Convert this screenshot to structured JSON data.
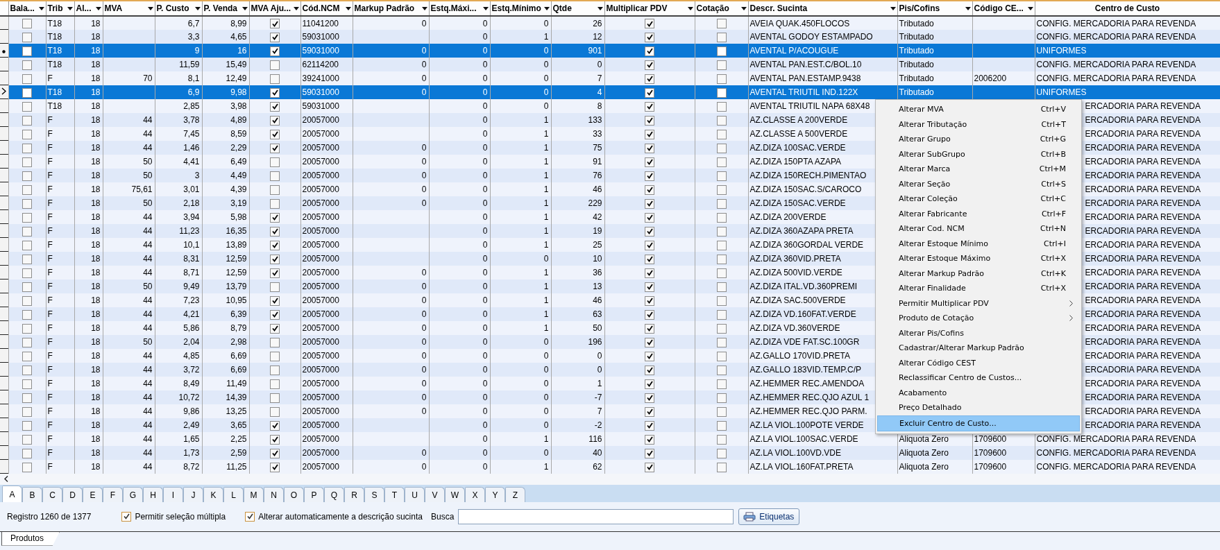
{
  "table": {
    "columns": [
      {
        "label": "Bala...",
        "filter": true
      },
      {
        "label": "Trib",
        "filter": true
      },
      {
        "label": "Al...",
        "filter": true
      },
      {
        "label": "MVA",
        "filter": true
      },
      {
        "label": "P. Custo",
        "filter": true
      },
      {
        "label": "P. Venda",
        "filter": true
      },
      {
        "label": "MVA Aju...",
        "filter": true
      },
      {
        "label": "Cód.NCM",
        "filter": true
      },
      {
        "label": "Markup Padrão",
        "filter": true
      },
      {
        "label": "Estq.Máxi...",
        "filter": true
      },
      {
        "label": "Estq.Mínimo",
        "filter": true
      },
      {
        "label": "Qtde",
        "filter": true
      },
      {
        "label": "Multiplicar PDV",
        "filter": true
      },
      {
        "label": "Cotação",
        "filter": true
      },
      {
        "label": "Descr. Sucinta",
        "filter": true
      },
      {
        "label": "Pis/Cofins",
        "filter": true
      },
      {
        "label": "Código CE...",
        "filter": true
      },
      {
        "label": "Centro de Custo",
        "filter": false
      }
    ],
    "rows": [
      {
        "selected": false,
        "current": false,
        "balanca": false,
        "trib": "T18",
        "aliq": "18",
        "p_custo": "6,7",
        "p_venda": "8,99",
        "mva_ajustado": true,
        "cod_ncm": "11041200",
        "markup": "0",
        "estq_max": "0",
        "estq_min": "0",
        "qtde": "26",
        "mult_pdv": true,
        "cotacao": false,
        "descr": "AVEIA QUAK.450FLOCOS",
        "pis_cofins": "Tributado",
        "centro_custo": "CONFIG. MERCADORIA PARA REVENDA"
      },
      {
        "selected": false,
        "current": false,
        "balanca": false,
        "trib": "T18",
        "aliq": "18",
        "p_custo": "3,3",
        "p_venda": "4,65",
        "mva_ajustado": true,
        "cod_ncm": "59031000",
        "estq_max": "0",
        "estq_min": "1",
        "qtde": "12",
        "mult_pdv": true,
        "cotacao": false,
        "descr": "AVENTAL GODOY ESTAMPADO",
        "pis_cofins": "Tributado",
        "centro_custo": "CONFIG. MERCADORIA PARA REVENDA"
      },
      {
        "selected": true,
        "current": false,
        "balanca": false,
        "trib": "T18",
        "aliq": "18",
        "p_custo": "9",
        "p_venda": "16",
        "mva_ajustado": true,
        "cod_ncm": "59031000",
        "markup": "0",
        "estq_max": "0",
        "estq_min": "0",
        "qtde": "901",
        "mult_pdv": true,
        "cotacao": false,
        "descr": "AVENTAL P/ACOUGUE",
        "pis_cofins": "Tributado",
        "centro_custo": "UNIFORMES"
      },
      {
        "selected": false,
        "current": false,
        "balanca": false,
        "trib": "T18",
        "aliq": "18",
        "p_custo": "11,59",
        "p_venda": "15,49",
        "mva_ajustado": false,
        "cod_ncm": "62114200",
        "markup": "0",
        "estq_max": "0",
        "estq_min": "0",
        "qtde": "0",
        "mult_pdv": true,
        "cotacao": false,
        "descr": "AVENTAL PAN.EST.C/BOL.10",
        "pis_cofins": "Tributado",
        "centro_custo": "CONFIG. MERCADORIA PARA REVENDA"
      },
      {
        "selected": false,
        "current": false,
        "balanca": false,
        "trib": "F",
        "aliq": "18",
        "mva": "70",
        "p_custo": "8,1",
        "p_venda": "12,49",
        "mva_ajustado": false,
        "cod_ncm": "39241000",
        "markup": "0",
        "estq_max": "0",
        "estq_min": "0",
        "qtde": "7",
        "mult_pdv": true,
        "cotacao": false,
        "descr": "AVENTAL PAN.ESTAMP.9438",
        "pis_cofins": "Tributado",
        "cest": "2006200",
        "centro_custo": "CONFIG. MERCADORIA PARA REVENDA"
      },
      {
        "selected": true,
        "current": true,
        "balanca": false,
        "trib": "T18",
        "aliq": "18",
        "p_custo": "6,9",
        "p_venda": "9,98",
        "mva_ajustado": true,
        "cod_ncm": "59031000",
        "markup": "0",
        "estq_max": "0",
        "estq_min": "0",
        "qtde": "4",
        "mult_pdv": true,
        "cotacao": false,
        "descr": "AVENTAL TRIUTIL IND.122X",
        "pis_cofins": "Tributado",
        "centro_custo": "UNIFORMES"
      },
      {
        "selected": false,
        "current": false,
        "balanca": false,
        "trib": "T18",
        "aliq": "18",
        "p_custo": "2,85",
        "p_venda": "3,98",
        "mva_ajustado": true,
        "cod_ncm": "59031000",
        "estq_max": "0",
        "estq_min": "0",
        "qtde": "8",
        "mult_pdv": true,
        "cotacao": false,
        "descr": "AVENTAL TRIUTIL NAPA 68X48",
        "centro_custo": "ERCADORIA PARA REVENDA"
      },
      {
        "selected": false,
        "current": false,
        "balanca": false,
        "trib": "F",
        "aliq": "18",
        "mva": "44",
        "p_custo": "3,78",
        "p_venda": "4,89",
        "mva_ajustado": true,
        "cod_ncm": "20057000",
        "estq_max": "0",
        "estq_min": "1",
        "qtde": "133",
        "mult_pdv": true,
        "cotacao": false,
        "descr": "AZ.CLASSE A 200VERDE",
        "centro_custo": "ERCADORIA PARA REVENDA"
      },
      {
        "selected": false,
        "current": false,
        "balanca": false,
        "trib": "F",
        "aliq": "18",
        "mva": "44",
        "p_custo": "7,45",
        "p_venda": "8,59",
        "mva_ajustado": true,
        "cod_ncm": "20057000",
        "estq_max": "0",
        "estq_min": "1",
        "qtde": "33",
        "mult_pdv": true,
        "cotacao": false,
        "descr": "AZ.CLASSE A 500VERDE",
        "centro_custo": "ERCADORIA PARA REVENDA"
      },
      {
        "selected": false,
        "current": false,
        "balanca": false,
        "trib": "F",
        "aliq": "18",
        "mva": "44",
        "p_custo": "1,46",
        "p_venda": "2,29",
        "mva_ajustado": true,
        "cod_ncm": "20057000",
        "markup": "0",
        "estq_max": "0",
        "estq_min": "1",
        "qtde": "75",
        "mult_pdv": true,
        "cotacao": false,
        "descr": "AZ.DIZA 100SAC.VERDE",
        "centro_custo": "ERCADORIA PARA REVENDA"
      },
      {
        "selected": false,
        "current": false,
        "balanca": false,
        "trib": "F",
        "aliq": "18",
        "mva": "50",
        "p_custo": "4,41",
        "p_venda": "6,49",
        "mva_ajustado": false,
        "cod_ncm": "20057000",
        "markup": "0",
        "estq_max": "0",
        "estq_min": "1",
        "qtde": "91",
        "mult_pdv": true,
        "cotacao": false,
        "descr": "AZ.DIZA 150PTA AZAPA",
        "centro_custo": "ERCADORIA PARA REVENDA"
      },
      {
        "selected": false,
        "current": false,
        "balanca": false,
        "trib": "F",
        "aliq": "18",
        "mva": "50",
        "p_custo": "3",
        "p_venda": "4,49",
        "mva_ajustado": false,
        "cod_ncm": "20057000",
        "markup": "0",
        "estq_max": "0",
        "estq_min": "1",
        "qtde": "76",
        "mult_pdv": true,
        "cotacao": false,
        "descr": "AZ.DIZA 150RECH.PIMENTAO",
        "centro_custo": "ERCADORIA PARA REVENDA"
      },
      {
        "selected": false,
        "current": false,
        "balanca": false,
        "trib": "F",
        "aliq": "18",
        "mva": "75,61",
        "p_custo": "3,01",
        "p_venda": "4,39",
        "mva_ajustado": false,
        "cod_ncm": "20057000",
        "markup": "0",
        "estq_max": "0",
        "estq_min": "1",
        "qtde": "46",
        "mult_pdv": true,
        "cotacao": false,
        "descr": "AZ.DIZA 150SAC.S/CAROCO",
        "centro_custo": "ERCADORIA PARA REVENDA"
      },
      {
        "selected": false,
        "current": false,
        "balanca": false,
        "trib": "F",
        "aliq": "18",
        "mva": "50",
        "p_custo": "2,18",
        "p_venda": "3,19",
        "mva_ajustado": false,
        "cod_ncm": "20057000",
        "markup": "0",
        "estq_max": "0",
        "estq_min": "1",
        "qtde": "229",
        "mult_pdv": true,
        "cotacao": false,
        "descr": "AZ.DIZA 150SAC.VERDE",
        "centro_custo": "ERCADORIA PARA REVENDA"
      },
      {
        "selected": false,
        "current": false,
        "balanca": false,
        "trib": "F",
        "aliq": "18",
        "mva": "44",
        "p_custo": "3,94",
        "p_venda": "5,98",
        "mva_ajustado": true,
        "cod_ncm": "20057000",
        "estq_max": "0",
        "estq_min": "1",
        "qtde": "42",
        "mult_pdv": true,
        "cotacao": false,
        "descr": "AZ.DIZA 200VERDE",
        "centro_custo": "ERCADORIA PARA REVENDA"
      },
      {
        "selected": false,
        "current": false,
        "balanca": false,
        "trib": "F",
        "aliq": "18",
        "mva": "44",
        "p_custo": "11,23",
        "p_venda": "16,35",
        "mva_ajustado": true,
        "cod_ncm": "20057000",
        "estq_max": "0",
        "estq_min": "1",
        "qtde": "19",
        "mult_pdv": true,
        "cotacao": false,
        "descr": "AZ.DIZA 360AZAPA PRETA",
        "centro_custo": "ERCADORIA PARA REVENDA"
      },
      {
        "selected": false,
        "current": false,
        "balanca": false,
        "trib": "F",
        "aliq": "18",
        "mva": "44",
        "p_custo": "10,1",
        "p_venda": "13,89",
        "mva_ajustado": true,
        "cod_ncm": "20057000",
        "estq_max": "0",
        "estq_min": "1",
        "qtde": "25",
        "mult_pdv": true,
        "cotacao": false,
        "descr": "AZ.DIZA 360GORDAL VERDE",
        "centro_custo": "ERCADORIA PARA REVENDA"
      },
      {
        "selected": false,
        "current": false,
        "balanca": false,
        "trib": "F",
        "aliq": "18",
        "mva": "44",
        "p_custo": "8,31",
        "p_venda": "12,59",
        "mva_ajustado": true,
        "cod_ncm": "20057000",
        "estq_max": "0",
        "estq_min": "0",
        "qtde": "10",
        "mult_pdv": true,
        "cotacao": false,
        "descr": "AZ.DIZA 360VID.PRETA",
        "centro_custo": "ERCADORIA PARA REVENDA"
      },
      {
        "selected": false,
        "current": false,
        "balanca": false,
        "trib": "F",
        "aliq": "18",
        "mva": "44",
        "p_custo": "8,71",
        "p_venda": "12,59",
        "mva_ajustado": true,
        "cod_ncm": "20057000",
        "markup": "0",
        "estq_max": "0",
        "estq_min": "1",
        "qtde": "36",
        "mult_pdv": true,
        "cotacao": false,
        "descr": "AZ.DIZA 500VID.VERDE",
        "centro_custo": "ERCADORIA PARA REVENDA"
      },
      {
        "selected": false,
        "current": false,
        "balanca": false,
        "trib": "F",
        "aliq": "18",
        "mva": "50",
        "p_custo": "9,49",
        "p_venda": "13,79",
        "mva_ajustado": false,
        "cod_ncm": "20057000",
        "markup": "0",
        "estq_max": "0",
        "estq_min": "1",
        "qtde": "13",
        "mult_pdv": true,
        "cotacao": false,
        "descr": "AZ.DIZA ITAL.VD.360PREMI",
        "centro_custo": "ERCADORIA PARA REVENDA"
      },
      {
        "selected": false,
        "current": false,
        "balanca": false,
        "trib": "F",
        "aliq": "18",
        "mva": "44",
        "p_custo": "7,23",
        "p_venda": "10,95",
        "mva_ajustado": true,
        "cod_ncm": "20057000",
        "markup": "0",
        "estq_max": "0",
        "estq_min": "1",
        "qtde": "46",
        "mult_pdv": true,
        "cotacao": false,
        "descr": "AZ.DIZA SAC.500VERDE",
        "centro_custo": "ERCADORIA PARA REVENDA"
      },
      {
        "selected": false,
        "current": false,
        "balanca": false,
        "trib": "F",
        "aliq": "18",
        "mva": "44",
        "p_custo": "4,21",
        "p_venda": "6,39",
        "mva_ajustado": true,
        "cod_ncm": "20057000",
        "markup": "0",
        "estq_max": "0",
        "estq_min": "1",
        "qtde": "63",
        "mult_pdv": true,
        "cotacao": false,
        "descr": "AZ.DIZA VD.160FAT.VERDE",
        "centro_custo": "ERCADORIA PARA REVENDA"
      },
      {
        "selected": false,
        "current": false,
        "balanca": false,
        "trib": "F",
        "aliq": "18",
        "mva": "44",
        "p_custo": "5,86",
        "p_venda": "8,79",
        "mva_ajustado": true,
        "cod_ncm": "20057000",
        "markup": "0",
        "estq_max": "0",
        "estq_min": "1",
        "qtde": "50",
        "mult_pdv": true,
        "cotacao": false,
        "descr": "AZ.DIZA VD.360VERDE",
        "centro_custo": "ERCADORIA PARA REVENDA"
      },
      {
        "selected": false,
        "current": false,
        "balanca": false,
        "trib": "F",
        "aliq": "18",
        "mva": "50",
        "p_custo": "2,04",
        "p_venda": "2,98",
        "mva_ajustado": false,
        "cod_ncm": "20057000",
        "markup": "0",
        "estq_max": "0",
        "estq_min": "0",
        "qtde": "196",
        "mult_pdv": true,
        "cotacao": false,
        "descr": "AZ.DIZA VDE FAT.SC.100GR",
        "centro_custo": "ERCADORIA PARA REVENDA"
      },
      {
        "selected": false,
        "current": false,
        "balanca": false,
        "trib": "F",
        "aliq": "18",
        "mva": "44",
        "p_custo": "4,85",
        "p_venda": "6,69",
        "mva_ajustado": false,
        "cod_ncm": "20057000",
        "markup": "0",
        "estq_max": "0",
        "estq_min": "0",
        "qtde": "0",
        "mult_pdv": true,
        "cotacao": false,
        "descr": "AZ.GALLO 170VID.PRETA",
        "centro_custo": "ERCADORIA PARA REVENDA"
      },
      {
        "selected": false,
        "current": false,
        "balanca": false,
        "trib": "F",
        "aliq": "18",
        "mva": "44",
        "p_custo": "3,72",
        "p_venda": "6,69",
        "mva_ajustado": false,
        "cod_ncm": "20057000",
        "markup": "0",
        "estq_max": "0",
        "estq_min": "0",
        "qtde": "0",
        "mult_pdv": true,
        "cotacao": false,
        "descr": "AZ.GALLO 183VID.TEMP.C/P",
        "centro_custo": "ERCADORIA PARA REVENDA"
      },
      {
        "selected": false,
        "current": false,
        "balanca": false,
        "trib": "F",
        "aliq": "18",
        "mva": "44",
        "p_custo": "8,49",
        "p_venda": "11,49",
        "mva_ajustado": false,
        "cod_ncm": "20057000",
        "markup": "0",
        "estq_max": "0",
        "estq_min": "0",
        "qtde": "1",
        "mult_pdv": true,
        "cotacao": false,
        "descr": "AZ.HEMMER REC.AMENDOA",
        "centro_custo": "ERCADORIA PARA REVENDA"
      },
      {
        "selected": false,
        "current": false,
        "balanca": false,
        "trib": "F",
        "aliq": "18",
        "mva": "44",
        "p_custo": "10,72",
        "p_venda": "14,39",
        "mva_ajustado": false,
        "cod_ncm": "20057000",
        "markup": "0",
        "estq_max": "0",
        "estq_min": "0",
        "qtde": "-7",
        "mult_pdv": true,
        "cotacao": false,
        "descr": "AZ.HEMMER REC.QJO AZUL 1",
        "centro_custo": "ERCADORIA PARA REVENDA"
      },
      {
        "selected": false,
        "current": false,
        "balanca": false,
        "trib": "F",
        "aliq": "18",
        "mva": "44",
        "p_custo": "9,86",
        "p_venda": "13,25",
        "mva_ajustado": false,
        "cod_ncm": "20057000",
        "markup": "0",
        "estq_max": "0",
        "estq_min": "0",
        "qtde": "7",
        "mult_pdv": true,
        "cotacao": false,
        "descr": "AZ.HEMMER REC.QJO PARM.",
        "centro_custo": "ERCADORIA PARA REVENDA"
      },
      {
        "selected": false,
        "current": false,
        "balanca": false,
        "trib": "F",
        "aliq": "18",
        "mva": "44",
        "p_custo": "2,49",
        "p_venda": "3,65",
        "mva_ajustado": true,
        "cod_ncm": "20057000",
        "estq_max": "0",
        "estq_min": "0",
        "qtde": "-2",
        "mult_pdv": true,
        "cotacao": false,
        "descr": "AZ.LA VIOL.100POTE VERDE",
        "centro_custo": "ERCADORIA PARA REVENDA"
      },
      {
        "selected": false,
        "current": false,
        "balanca": false,
        "trib": "F",
        "aliq": "18",
        "mva": "44",
        "p_custo": "1,65",
        "p_venda": "2,25",
        "mva_ajustado": true,
        "cod_ncm": "20057000",
        "estq_max": "0",
        "estq_min": "1",
        "qtde": "116",
        "mult_pdv": true,
        "cotacao": false,
        "descr": "AZ.LA VIOL.100SAC.VERDE",
        "pis_cofins": "Aliquota Zero",
        "cest": "1709600",
        "centro_custo": "CONFIG. MERCADORIA PARA REVENDA"
      },
      {
        "selected": false,
        "current": false,
        "balanca": false,
        "trib": "F",
        "aliq": "18",
        "mva": "44",
        "p_custo": "1,73",
        "p_venda": "2,59",
        "mva_ajustado": true,
        "cod_ncm": "20057000",
        "markup": "0",
        "estq_max": "0",
        "estq_min": "0",
        "qtde": "40",
        "mult_pdv": true,
        "cotacao": false,
        "descr": "AZ.LA VIOL.100VD.VDE",
        "pis_cofins": "Aliquota Zero",
        "cest": "1709600",
        "centro_custo": "CONFIG. MERCADORIA PARA REVENDA"
      },
      {
        "selected": false,
        "current": false,
        "balanca": false,
        "trib": "F",
        "aliq": "18",
        "mva": "44",
        "p_custo": "8,72",
        "p_venda": "11,25",
        "mva_ajustado": true,
        "cod_ncm": "20057000",
        "markup": "0",
        "estq_max": "0",
        "estq_min": "1",
        "qtde": "62",
        "mult_pdv": true,
        "cotacao": false,
        "descr": "AZ.LA VIOL.160FAT.PRETA",
        "pis_cofins": "Aliquota Zero",
        "cest": "1709600",
        "centro_custo": "CONFIG. MERCADORIA PARA REVENDA"
      }
    ]
  },
  "context_menu": {
    "items": [
      {
        "label": "Alterar MVA",
        "shortcut": "Ctrl+V",
        "submenu": false,
        "selected": false
      },
      {
        "label": "Alterar Tributação",
        "shortcut": "Ctrl+T",
        "submenu": false,
        "selected": false
      },
      {
        "label": "Alterar Grupo",
        "shortcut": "Ctrl+G",
        "submenu": false,
        "selected": false
      },
      {
        "label": "Alterar SubGrupo",
        "shortcut": "Ctrl+B",
        "submenu": false,
        "selected": false
      },
      {
        "label": "Alterar Marca",
        "shortcut": "Ctrl+M",
        "submenu": false,
        "selected": false
      },
      {
        "label": "Alterar Seção",
        "shortcut": "Ctrl+S",
        "submenu": false,
        "selected": false
      },
      {
        "label": "Alterar Coleção",
        "shortcut": "Ctrl+C",
        "submenu": false,
        "selected": false
      },
      {
        "label": "Alterar Fabricante",
        "shortcut": "Ctrl+F",
        "submenu": false,
        "selected": false
      },
      {
        "label": "Alterar Cod. NCM",
        "shortcut": "Ctrl+N",
        "submenu": false,
        "selected": false
      },
      {
        "label": "Alterar Estoque Mínimo",
        "shortcut": "Ctrl+I",
        "submenu": false,
        "selected": false
      },
      {
        "label": "Alterar Estoque Máximo",
        "shortcut": "Ctrl+X",
        "submenu": false,
        "selected": false
      },
      {
        "label": "Alterar Markup Padrão",
        "shortcut": "Ctrl+K",
        "submenu": false,
        "selected": false
      },
      {
        "label": "Alterar Finalidade",
        "shortcut": "Ctrl+X",
        "submenu": false,
        "selected": false
      },
      {
        "label": "Permitir Multiplicar PDV",
        "submenu": true,
        "selected": false
      },
      {
        "label": "Produto de Cotação",
        "submenu": true,
        "selected": false
      },
      {
        "label": "Alterar Pis/Cofins",
        "submenu": false,
        "selected": false
      },
      {
        "label": "Cadastrar/Alterar Markup Padrão",
        "submenu": false,
        "selected": false
      },
      {
        "label": "Alterar Código CEST",
        "submenu": false,
        "selected": false
      },
      {
        "label": "Reclassificar Centro de Custos...",
        "submenu": false,
        "selected": false
      },
      {
        "label": "Acabamento",
        "submenu": false,
        "selected": false
      },
      {
        "label": "Preço Detalhado",
        "submenu": false,
        "selected": false
      },
      {
        "label": "Excluir Centro de Custo...",
        "submenu": false,
        "selected": true
      }
    ]
  },
  "letter_tabs": [
    {
      "label": "A",
      "selected": true
    },
    {
      "label": "B",
      "selected": false
    },
    {
      "label": "C",
      "selected": false
    },
    {
      "label": "D",
      "selected": false
    },
    {
      "label": "E",
      "selected": false
    },
    {
      "label": "F",
      "selected": false
    },
    {
      "label": "G",
      "selected": false
    },
    {
      "label": "H",
      "selected": false
    },
    {
      "label": "I",
      "selected": false
    },
    {
      "label": "J",
      "selected": false
    },
    {
      "label": "K",
      "selected": false
    },
    {
      "label": "L",
      "selected": false
    },
    {
      "label": "M",
      "selected": false
    },
    {
      "label": "N",
      "selected": false
    },
    {
      "label": "O",
      "selected": false
    },
    {
      "label": "P",
      "selected": false
    },
    {
      "label": "Q",
      "selected": false
    },
    {
      "label": "R",
      "selected": false
    },
    {
      "label": "S",
      "selected": false
    },
    {
      "label": "T",
      "selected": false
    },
    {
      "label": "U",
      "selected": false
    },
    {
      "label": "V",
      "selected": false
    },
    {
      "label": "W",
      "selected": false
    },
    {
      "label": "X",
      "selected": false
    },
    {
      "label": "Y",
      "selected": false
    },
    {
      "label": "Z",
      "selected": false
    }
  ],
  "status": {
    "record_count": "Registro 1260 de 1377",
    "options": [
      {
        "label": "Permitir seleção múltipla",
        "checked": true
      },
      {
        "label": "Alterar automaticamente a descrição sucinta",
        "checked": true
      }
    ],
    "search": {
      "label": "Busca"
    },
    "button": "Etiquetas"
  },
  "bottom_tabs": [
    {
      "label": "Produtos",
      "selected": true
    }
  ]
}
